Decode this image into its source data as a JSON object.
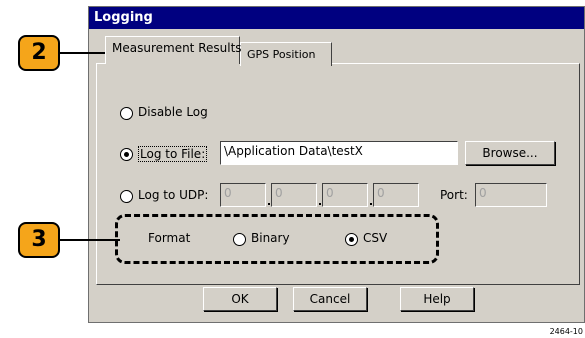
{
  "window": {
    "title": "Logging"
  },
  "tabs": [
    {
      "label": "Measurement Results"
    },
    {
      "label": "GPS Position"
    }
  ],
  "log_options": {
    "disable": {
      "label": "Disable Log",
      "checked": false
    },
    "file": {
      "label": "Log to File:",
      "checked": true,
      "value": "\\Application Data\\testX"
    },
    "udp": {
      "label": "Log to UDP:",
      "checked": false,
      "ip": [
        "0",
        "0",
        "0",
        "0"
      ],
      "port_label": "Port:",
      "port_value": "0"
    }
  },
  "browse_label": "Browse...",
  "format": {
    "label": "Format",
    "options": [
      {
        "label": "Binary",
        "checked": false
      },
      {
        "label": "CSV",
        "checked": true
      }
    ]
  },
  "buttons": {
    "ok": "OK",
    "cancel": "Cancel",
    "help": "Help"
  },
  "callouts": [
    "2",
    "3"
  ],
  "figure_id": "2464-10"
}
